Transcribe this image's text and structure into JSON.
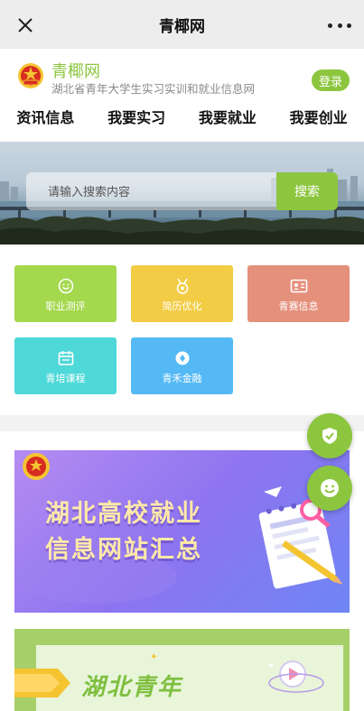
{
  "topbar": {
    "title": "青椰网"
  },
  "brand": {
    "name": "青椰网",
    "subtitle": "湖北省青年大学生实习实训和就业信息网",
    "login_label": "登录"
  },
  "nav": [
    {
      "label": "资讯信息"
    },
    {
      "label": "我要实习"
    },
    {
      "label": "我要就业"
    },
    {
      "label": "我要创业"
    }
  ],
  "search": {
    "placeholder": "请输入搜索内容",
    "button_label": "搜索"
  },
  "tiles": [
    {
      "label": "职业测评",
      "icon": "smiley-icon",
      "color": "#a4d84d"
    },
    {
      "label": "简历优化",
      "icon": "medal-icon",
      "color": "#f2cc45"
    },
    {
      "label": "青赛信息",
      "icon": "id-card-icon",
      "color": "#e4907b"
    },
    {
      "label": "青培课程",
      "icon": "calendar-icon",
      "color": "#4ed8d8"
    },
    {
      "label": "青禾金融",
      "icon": "coin-icon",
      "color": "#55b9f5"
    }
  ],
  "promos": [
    {
      "line1": "湖北高校就业",
      "line2": "信息网站汇总"
    },
    {
      "title": "湖北青年"
    }
  ],
  "colors": {
    "accent": "#8cc63f",
    "topbar_bg": "#ededed",
    "divider": "#f2f2f2"
  }
}
